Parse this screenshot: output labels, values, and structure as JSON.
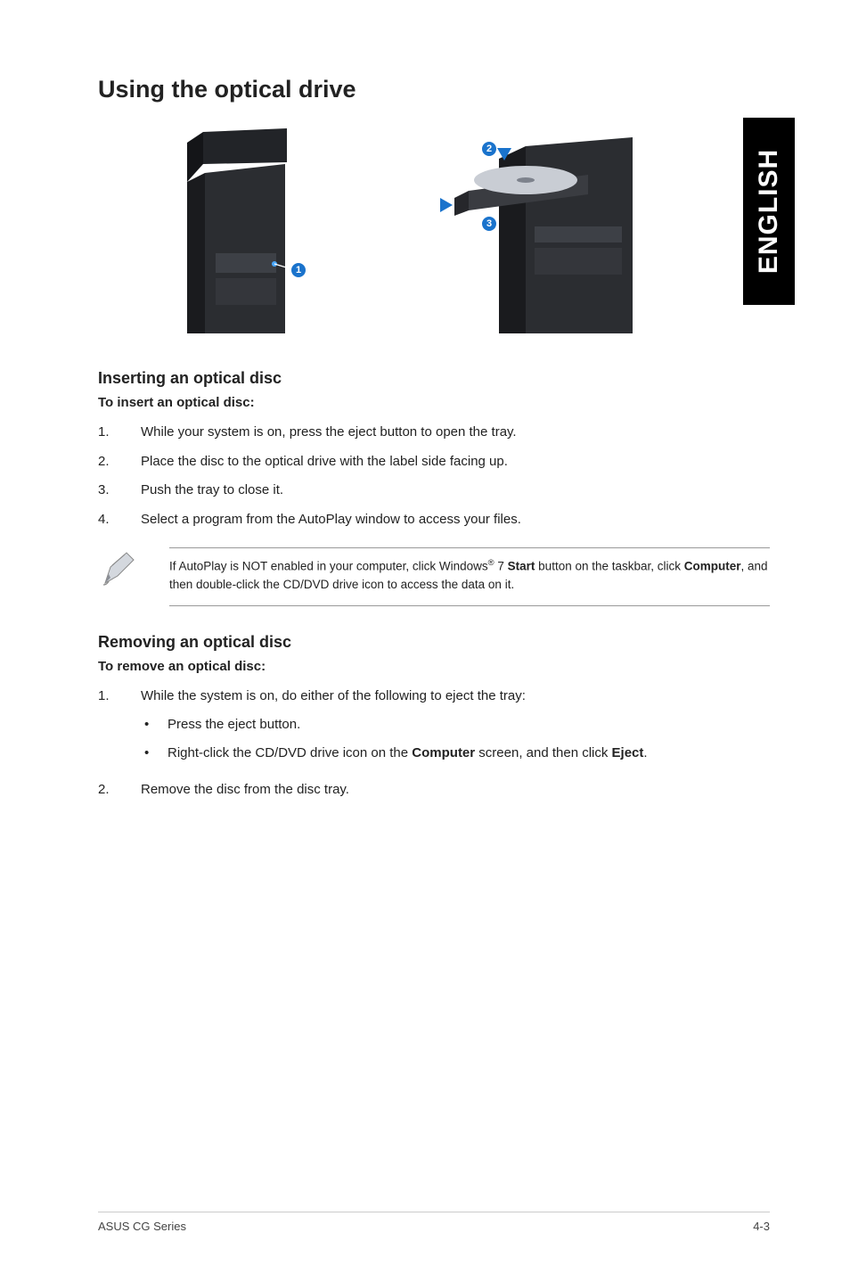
{
  "lang_tab": "ENGLISH",
  "h1": "Using the optical drive",
  "insert": {
    "heading": "Inserting an optical disc",
    "sub": "To insert an optical disc:",
    "steps": [
      "While your system is on, press the eject button to open the tray.",
      "Place the disc to the optical drive with the label side facing up.",
      "Push the tray to close it.",
      "Select a program from the AutoPlay window to access your files."
    ]
  },
  "note": {
    "pre": "If AutoPlay is NOT enabled in your computer, click Windows",
    "sup": "®",
    "mid1": " 7 ",
    "bold1": "Start",
    "mid2": " button on the taskbar, click ",
    "bold2": "Computer",
    "post": ", and then double-click the CD/DVD drive icon to access the data on it."
  },
  "remove": {
    "heading": "Removing an optical disc",
    "sub": "To remove an optical disc:",
    "step1": "While the system is on, do either of the following to eject the tray:",
    "sub1": "Press the eject button.",
    "sub2_pre": "Right-click the CD/DVD drive icon on the ",
    "sub2_b1": "Computer",
    "sub2_mid": " screen, and then click ",
    "sub2_b2": "Eject",
    "sub2_post": ".",
    "step2": "Remove the disc from the disc tray."
  },
  "callouts": {
    "c1": "1",
    "c2": "2",
    "c3": "3"
  },
  "footer": {
    "left": "ASUS CG Series",
    "right": "4-3"
  }
}
